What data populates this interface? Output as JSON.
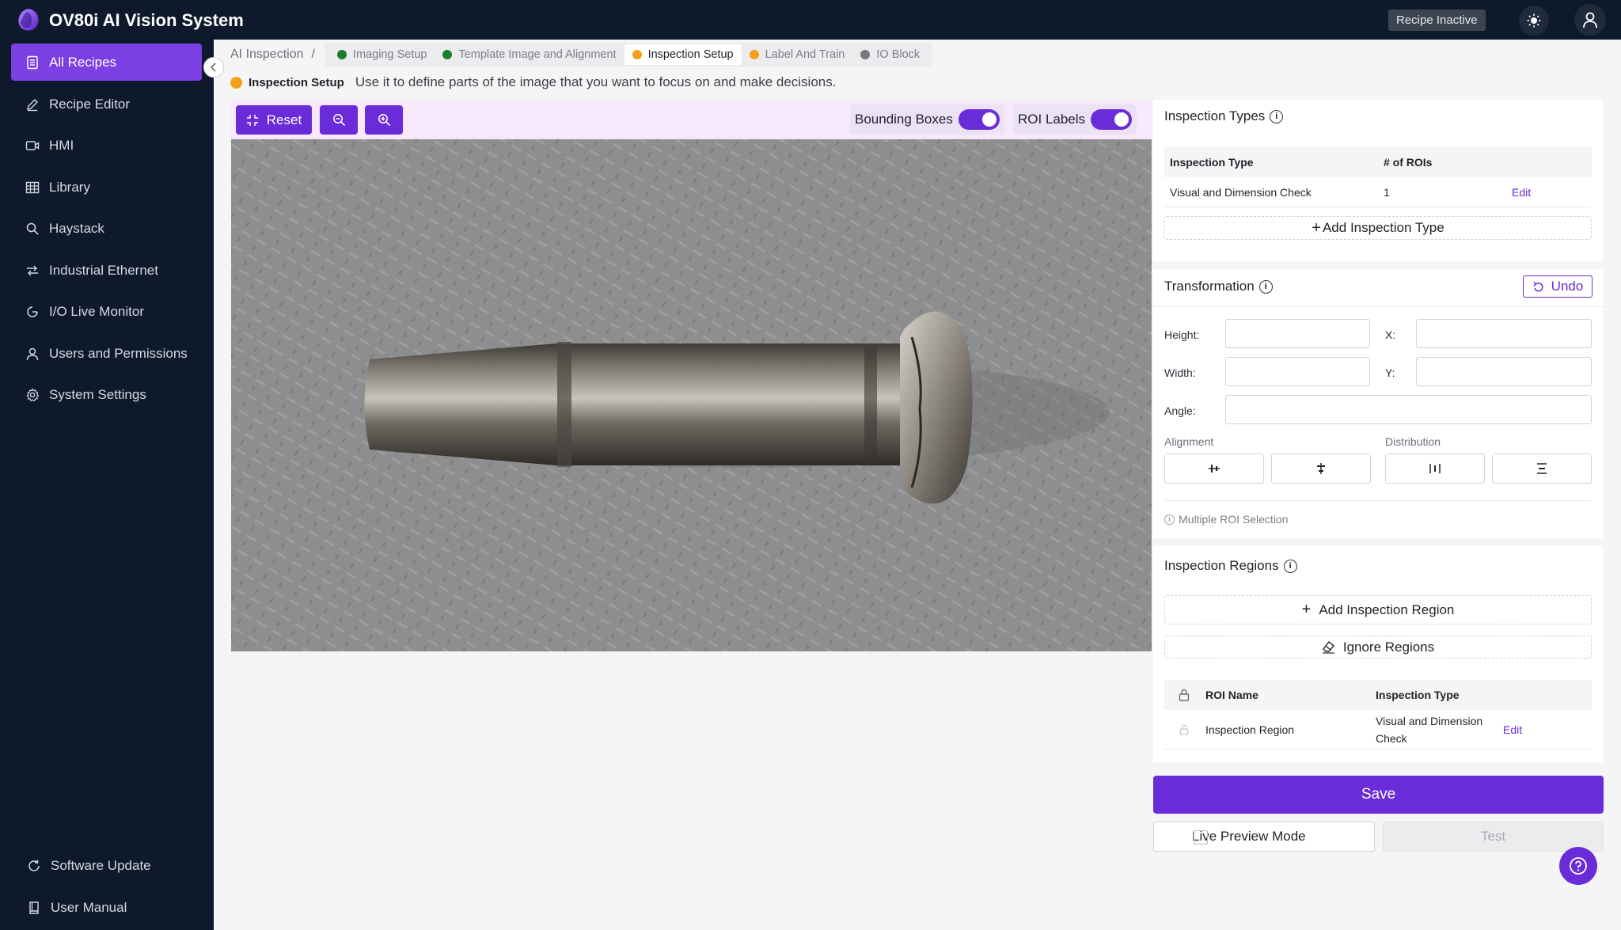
{
  "app": {
    "title": "OV80i AI Vision System",
    "status": "Recipe Inactive"
  },
  "sidebar": {
    "items": [
      {
        "label": "All Recipes",
        "icon": "file-list-icon"
      },
      {
        "label": "Recipe Editor",
        "icon": "pen-icon"
      },
      {
        "label": "HMI",
        "icon": "video-icon"
      },
      {
        "label": "Library",
        "icon": "table-icon"
      },
      {
        "label": "Haystack",
        "icon": "search-icon"
      },
      {
        "label": "Industrial Ethernet",
        "icon": "ethernet-icon"
      },
      {
        "label": "I/O Live Monitor",
        "icon": "monitor-icon"
      },
      {
        "label": "Users and Permissions",
        "icon": "user-icon"
      },
      {
        "label": "System Settings",
        "icon": "gear-icon"
      }
    ],
    "footer": [
      {
        "label": "Software Update",
        "icon": "refresh-icon"
      },
      {
        "label": "User Manual",
        "icon": "book-icon"
      }
    ]
  },
  "breadcrumb": {
    "root": "AI Inspection",
    "sep": "/",
    "steps": [
      {
        "label": "Imaging Setup",
        "color": "#1a7f2b"
      },
      {
        "label": "Template Image and Alignment",
        "color": "#1a7f2b"
      },
      {
        "label": "Inspection Setup",
        "color": "#f5a01a"
      },
      {
        "label": "Label And Train",
        "color": "#f5a01a"
      },
      {
        "label": "IO Block",
        "color": "#777b80"
      }
    ]
  },
  "subhead": {
    "label": "Inspection Setup",
    "desc": "Use it to define parts of the image that you want to focus on and make decisions."
  },
  "toolbar": {
    "reset": "Reset",
    "bounding_boxes": "Bounding Boxes",
    "roi_labels": "ROI Labels"
  },
  "inspection_types": {
    "title": "Inspection Types",
    "columns": [
      "Inspection Type",
      "# of ROIs"
    ],
    "rows": [
      {
        "type": "Visual and Dimension Check",
        "count": "1",
        "action": "Edit"
      }
    ],
    "add": "Add Inspection Type"
  },
  "transformation": {
    "title": "Transformation",
    "undo": "Undo",
    "height": "Height:",
    "width": "Width:",
    "x": "X:",
    "y": "Y:",
    "angle": "Angle:",
    "alignment": "Alignment",
    "distribution": "Distribution",
    "multi": "Multiple ROI Selection"
  },
  "regions": {
    "title": "Inspection Regions",
    "add": "Add Inspection Region",
    "ignore": "Ignore Regions",
    "columns": [
      "ROI Name",
      "Inspection Type"
    ],
    "rows": [
      {
        "name": "Inspection Region",
        "type_line1": "Visual and Dimension",
        "type_line2": "Check",
        "action": "Edit"
      }
    ]
  },
  "actions": {
    "save": "Save",
    "live_preview": "Live Preview Mode",
    "test": "Test"
  }
}
